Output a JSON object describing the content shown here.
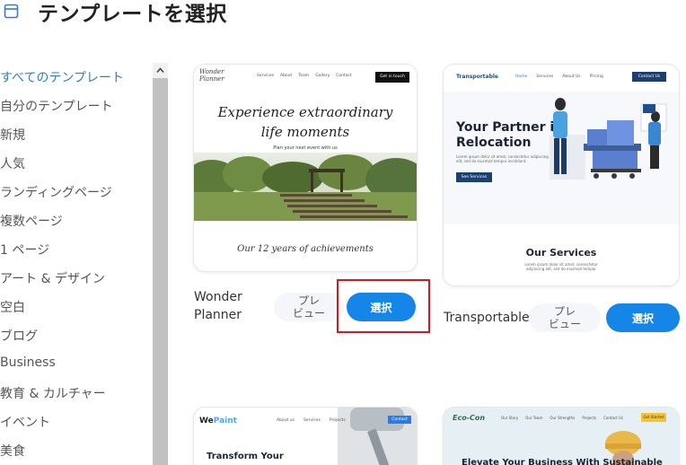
{
  "header": {
    "title": "テンプレートを選択",
    "icon": "template-window-icon"
  },
  "sidebar": {
    "active_color": "#2f7bdc",
    "items": [
      {
        "label": "すべてのテンプレート",
        "active": true
      },
      {
        "label": "自分のテンプレート"
      },
      {
        "label": "新規"
      },
      {
        "label": "人気"
      },
      {
        "label": "ランディングページ"
      },
      {
        "label": "複数ページ"
      },
      {
        "label": "1 ページ"
      },
      {
        "label": "アート & デザイン"
      },
      {
        "label": "空白"
      },
      {
        "label": "ブログ"
      },
      {
        "label": "Business"
      },
      {
        "label": "教育 & カルチャー"
      },
      {
        "label": "イベント"
      },
      {
        "label": "美食"
      }
    ]
  },
  "buttons": {
    "preview_label": "プレ\nビュー",
    "select_label": "選択",
    "select_color": "#1685e8",
    "highlight_color": "#e3121a"
  },
  "templates": [
    {
      "name": "Wonder\nPlanner",
      "thumb": {
        "logo": "Wonder\nPlanner",
        "nav": [
          "Services",
          "About",
          "Team",
          "Gallery",
          "Contact"
        ],
        "cta": "Get in touch",
        "hero_title": "Experience extraordinary\nlife moments",
        "hero_sub": "Plan your next event with us",
        "section": "Our 12 years of achievements"
      }
    },
    {
      "name": "Transportable",
      "thumb": {
        "logo": "Transportable",
        "nav": [
          "Home",
          "Services",
          "About Us",
          "Pricing"
        ],
        "cta": "Contact Us",
        "headline": "Your Partner in\nRelocation",
        "desc": "Lorem ipsum dolor sit amet, consectetur adipiscing elit, sed do eiusmod tempor incididunt.",
        "button": "See Services",
        "section": "Our Services",
        "section_desc": "Lorem ipsum dolor sit amet, consectetur adipiscing elit, sed do eiusmod tempor"
      }
    },
    {
      "name": "",
      "thumb": {
        "logo_a": "We",
        "logo_b": "Paint",
        "nav": [
          "About us",
          "Services",
          "Projects"
        ],
        "cta": "Contact",
        "headline": "Transform Your"
      }
    },
    {
      "name": "",
      "thumb": {
        "logo": "Eco-Con",
        "nav": [
          "Our Story",
          "Our Team",
          "Our Strengths",
          "Projects",
          "Contact Us"
        ],
        "cta": "Get Started",
        "headline": "Elevate Your Business With Sustainable"
      }
    }
  ]
}
